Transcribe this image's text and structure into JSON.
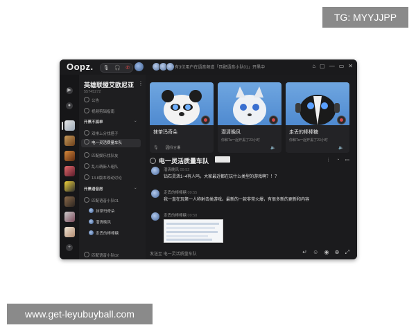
{
  "watermark": {
    "top_right": "TG: MYYJJPP",
    "bottom_left": "www.get-leyubuyball.com"
  },
  "app": {
    "logo": "Oopz."
  },
  "titlebar": {
    "notice": "有3位用户在语音频道「匹配语音小队01」开黑中",
    "controls": [
      "⌂",
      "▢",
      "—",
      "▭",
      "✕"
    ]
  },
  "server": {
    "name": "英雄联盟艾欧尼亚",
    "id": "55745272",
    "channels_top": [
      {
        "label": "公告",
        "icon": "megaphone-icon"
      },
      {
        "label": "视频剪辑指南",
        "icon": "book-icon"
      }
    ],
    "group_1": {
      "label": "开黑不孤单",
      "channels": [
        {
          "label": "双排上分找搭子",
          "active": false
        },
        {
          "label": "电一灵活质量车队",
          "active": true
        },
        {
          "label": "匹配娱乐找队友",
          "active": false
        },
        {
          "label": "乱斗萌新人组队",
          "active": false
        },
        {
          "label": "13.8版本改动讨论",
          "active": false
        }
      ]
    },
    "group_2": {
      "label": "开黑语音房",
      "channels": [
        {
          "label": "匹配语音小队01"
        }
      ],
      "users": [
        "抹茶玛奇朵",
        "潜清晚风",
        "走丢的棒棒糖"
      ]
    },
    "footer": "匹配语音小队02"
  },
  "cards": [
    {
      "title": "抹茶玛奇朵",
      "sub": "自我言语"
    },
    {
      "title": "潜清晚风",
      "sub": "你和Ta一起开黑了23小时"
    },
    {
      "title": "走丢的棒棒糖",
      "sub": "你和Ta一起开黑了23小时"
    }
  ],
  "chat": {
    "title": "电一灵活质量车队",
    "messages": [
      {
        "name": "潜清晚风",
        "time": "09:52",
        "text": "钻石灵活1~4有人吗，大家最近都在玩什么类型的游戏啊？！？"
      },
      {
        "name": "走丢的棒棒糖",
        "time": "09:55",
        "text": "我一直在玩第一人称射击类游戏。最新的一款非常火爆，有很多新的更新和内容"
      },
      {
        "name": "走丢的棒棒糖",
        "time": "09:58",
        "text": ""
      }
    ],
    "input_placeholder": "发送至 电一灵活质量车队"
  },
  "colors": {
    "background": "#1c1c1e",
    "card_sky": "#5b98da",
    "accent_red": "#d24a4a"
  }
}
